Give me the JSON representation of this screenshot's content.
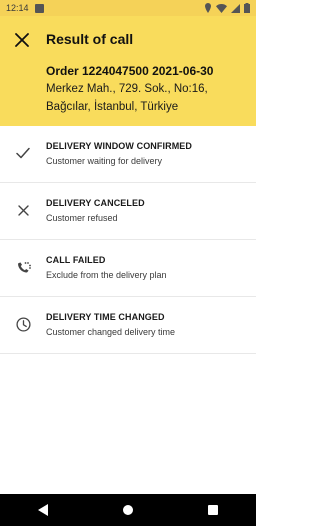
{
  "status_bar": {
    "time": "12:14",
    "icons": [
      "notification-icon",
      "location-icon",
      "wifi-icon",
      "signal-icon",
      "battery-icon"
    ]
  },
  "header": {
    "title": "Result of call",
    "order": "Order 1224047500 2021-06-30",
    "address": "Merkez Mah., 729. Sok., No:16, Bağcılar, İstanbul, Türkiye",
    "background": "#f9dc5c"
  },
  "options": [
    {
      "icon": "check-icon",
      "title": "DELIVERY WINDOW CONFIRMED",
      "subtitle": "Customer waiting for delivery"
    },
    {
      "icon": "close-icon",
      "title": "DELIVERY CANCELED",
      "subtitle": "Customer refused"
    },
    {
      "icon": "phone-missed-icon",
      "title": "CALL FAILED",
      "subtitle": "Exclude from the delivery plan"
    },
    {
      "icon": "clock-icon",
      "title": "DELIVERY TIME CHANGED",
      "subtitle": "Customer changed delivery time"
    }
  ],
  "nav_bar": {
    "icons": [
      "back-icon",
      "home-icon",
      "recents-icon"
    ]
  }
}
